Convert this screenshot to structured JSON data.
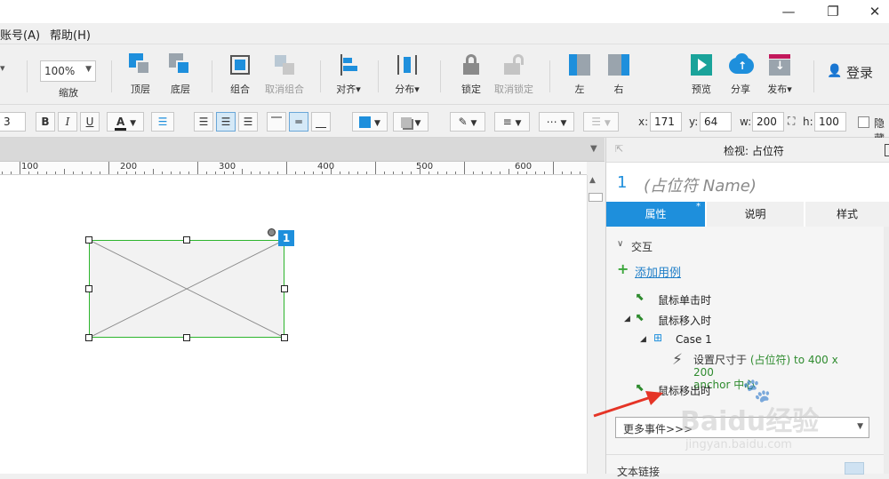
{
  "window": {
    "minimize": "—",
    "restore": "❐",
    "close": "✕"
  },
  "menu": {
    "account": "账号(A)",
    "help": "帮助(H)"
  },
  "toolbar": {
    "zoom_value": "100%",
    "zoom_label": "缩放",
    "top_label": "顶层",
    "bottom_label": "底层",
    "group_label": "组合",
    "ungroup_label": "取消组合",
    "align_label": "对齐",
    "distribute_label": "分布",
    "lock_label": "锁定",
    "unlock_label": "取消锁定",
    "left_label": "左",
    "right_label": "右",
    "preview_label": "预览",
    "share_label": "分享",
    "publish_label": "发布",
    "login_label": "登录"
  },
  "format": {
    "font_size": "3",
    "bold": "B",
    "italic": "I",
    "underline": "U",
    "font_color_glyph": "A",
    "x_label": "x:",
    "x_value": "171",
    "y_label": "y:",
    "y_value": "64",
    "w_label": "w:",
    "w_value": "200",
    "h_label": "h:",
    "h_value": "100",
    "hidden_label": "隐藏"
  },
  "ruler": {
    "ticks": [
      "100",
      "200",
      "300",
      "400",
      "500",
      "600"
    ]
  },
  "widget": {
    "badge": "1"
  },
  "panel": {
    "header_title": "检视: 占位符",
    "widget_number": "1",
    "widget_name_placeholder": "(占位符 Name)",
    "tabs": [
      "属性",
      "说明",
      "样式"
    ],
    "section_title": "交互",
    "add_case": "添加用例",
    "events": {
      "onclick": "鼠标单击时",
      "onmouseenter": "鼠标移入时",
      "case_name": "Case 1",
      "action_prefix": "设置尺寸于",
      "action_detail": "(占位符) to 400 x 200",
      "action_anchor": "anchor 中心",
      "onmouseleave": "鼠标移出时"
    },
    "more_events": "更多事件>>>",
    "text_link": "文本链接"
  },
  "watermark": {
    "brand": "Baidu经验",
    "url": "jingyan.baidu.com"
  },
  "colors": {
    "accent": "#1e8fdc",
    "green": "#2e8b2e",
    "selection": "#2db52d",
    "arrow": "#e53426"
  }
}
